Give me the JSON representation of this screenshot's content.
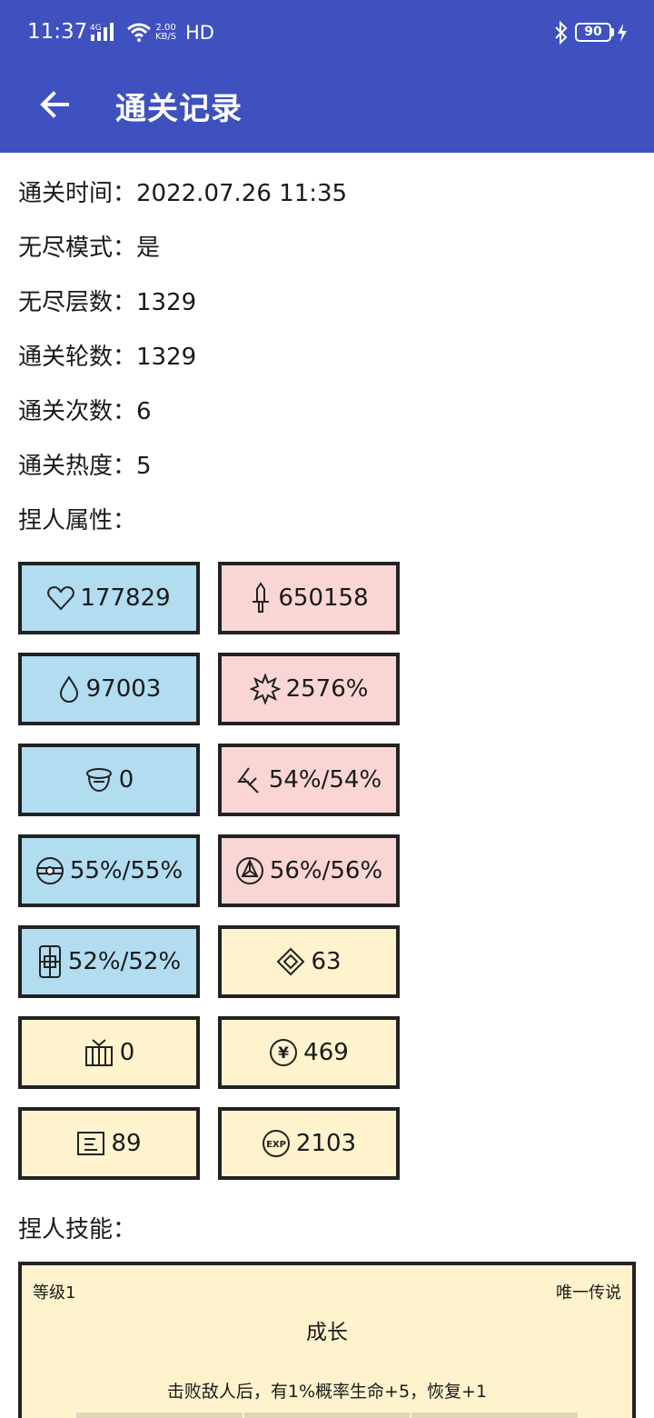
{
  "status_bar": {
    "time": "11:37",
    "network_type": "4G",
    "speed_value": "2.00",
    "speed_unit": "KB/S",
    "hd": "HD",
    "battery": "90"
  },
  "app_bar": {
    "title": "通关记录"
  },
  "info": [
    {
      "label": "通关时间：",
      "value": "2022.07.26 11:35"
    },
    {
      "label": "无尽模式：",
      "value": "是"
    },
    {
      "label": "无尽层数：",
      "value": "1329"
    },
    {
      "label": "通关轮数：",
      "value": "1329"
    },
    {
      "label": "通关次数：",
      "value": "6"
    },
    {
      "label": "通关热度：",
      "value": "5"
    }
  ],
  "attributes_header": "捏人属性：",
  "stats": [
    {
      "icon": "heart-icon",
      "value": "177829",
      "color": "blue"
    },
    {
      "icon": "sword-icon",
      "value": "650158",
      "color": "pink"
    },
    {
      "icon": "drop-icon",
      "value": "97003",
      "color": "blue"
    },
    {
      "icon": "burst-icon",
      "value": "2576%",
      "color": "pink"
    },
    {
      "icon": "helmet-icon",
      "value": "0",
      "color": "blue"
    },
    {
      "icon": "slash-icon",
      "value": "54%/54%",
      "color": "pink"
    },
    {
      "icon": "shield-orb-icon",
      "value": "55%/55%",
      "color": "blue"
    },
    {
      "icon": "triangle-nodes-icon",
      "value": "56%/56%",
      "color": "pink"
    },
    {
      "icon": "block-icon",
      "value": "52%/52%",
      "color": "blue"
    },
    {
      "icon": "diamond-icon",
      "value": "63",
      "color": "yellow"
    },
    {
      "icon": "tv-icon",
      "value": "0",
      "color": "yellow"
    },
    {
      "icon": "yen-coin-icon",
      "value": "469",
      "color": "yellow"
    },
    {
      "icon": "card-icon",
      "value": "89",
      "color": "yellow"
    },
    {
      "icon": "exp-icon",
      "value": "2103",
      "color": "yellow"
    }
  ],
  "skills_header": "捏人技能：",
  "skill": {
    "level": "等级1",
    "rarity": "唯一传说",
    "name": "成长",
    "description": "击败敌人后，有1%概率生命+5，恢复+1"
  },
  "colors": {
    "primary": "#3f51bf",
    "blue_cell": "#b2dcf0",
    "pink_cell": "#f9d6d3",
    "yellow_cell": "#fff3cd"
  }
}
